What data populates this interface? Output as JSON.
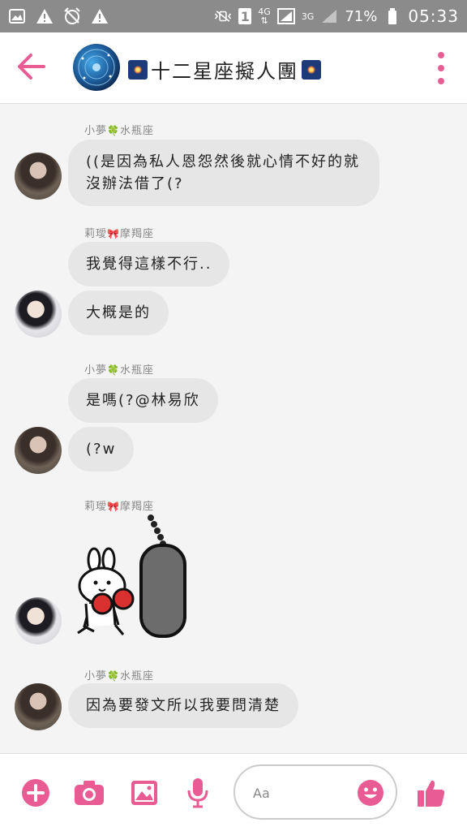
{
  "status_bar": {
    "battery_percent": "71%",
    "time": "05:33",
    "network_1": "4G",
    "network_2": "3G",
    "sim_slot": "1"
  },
  "header": {
    "title": "十二星座擬人團",
    "accent_color": "#e85c93"
  },
  "messages": [
    {
      "sender": "小夢",
      "sender_sign": "水瓶座",
      "text": "((是因為私人恩怨然後就心情不好的就沒辦法借了(?"
    },
    {
      "sender": "莉璦",
      "sender_sign": "摩羯座",
      "text": "我覺得這樣不行.."
    },
    {
      "text": "大概是的"
    },
    {
      "sender": "小夢",
      "sender_sign": "水瓶座",
      "text": "是嗎(?@林易欣"
    },
    {
      "text": "(?w"
    },
    {
      "sender": "莉璦",
      "sender_sign": "摩羯座"
    },
    {
      "sender": "小夢",
      "sender_sign": "水瓶座",
      "text": "因為要發文所以我要問清楚"
    }
  ],
  "composer": {
    "placeholder": "Aa"
  },
  "icons": {
    "back": "arrow-left-icon",
    "more": "more-vertical-icon",
    "add": "plus-circle-icon",
    "camera": "camera-icon",
    "image": "image-icon",
    "mic": "microphone-icon",
    "emoji": "smile-icon",
    "like": "thumbs-up-icon"
  }
}
